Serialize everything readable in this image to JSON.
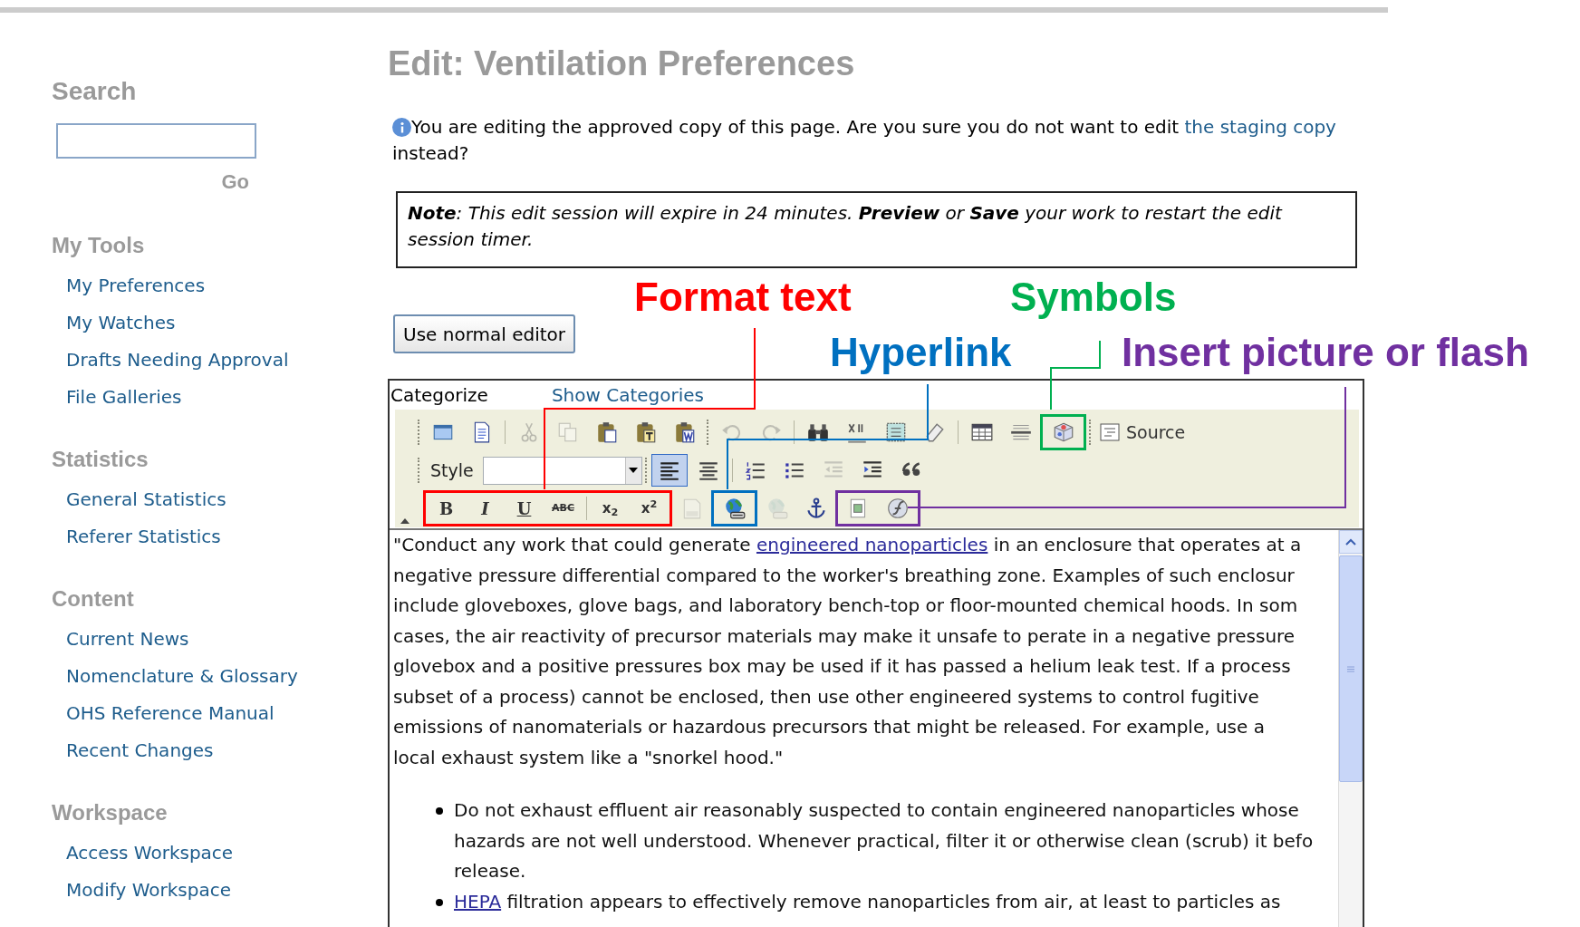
{
  "sidebar": {
    "search": {
      "heading": "Search",
      "button": "Go"
    },
    "sections": [
      {
        "heading": "My Tools",
        "items": [
          "My Preferences",
          "My Watches",
          "Drafts Needing Approval",
          "File Galleries"
        ]
      },
      {
        "heading": "Statistics",
        "items": [
          "General Statistics",
          "Referer Statistics"
        ]
      },
      {
        "heading": "Content",
        "items": [
          "Current News",
          "Nomenclature & Glossary",
          "OHS Reference Manual",
          "Recent Changes"
        ]
      },
      {
        "heading": "Workspace",
        "items": [
          "Access Workspace",
          "Modify Workspace"
        ]
      }
    ]
  },
  "page": {
    "title": "Edit: Ventilation Preferences",
    "notice": {
      "text": "You are editing the approved copy of this page. Are you sure you do not want to edit ",
      "link": "the staging copy",
      "tail": "instead?"
    },
    "note": "**Note**: This edit session will expire in 24 minutes. **Preview** or **Save** your work to restart the edit session timer.",
    "button": "Use normal editor"
  },
  "annotations": [
    {
      "text": "Format text",
      "color": "#ff0000"
    },
    {
      "text": "Symbols",
      "color": "#00b050"
    },
    {
      "text": "Hyperlink",
      "color": "#0070c0"
    },
    {
      "text": "Insert picture or flash",
      "color": "#7030a0"
    }
  ],
  "editor": {
    "categorize": "Categorize",
    "show_categories": "Show Categories",
    "toolbar": [
      [
        {
          "kind": "preview",
          "disabled": false,
          "selected": false
        },
        {
          "kind": "newpage",
          "disabled": false,
          "selected": false
        },
        {
          "kind": "divider"
        },
        {
          "kind": "cut",
          "disabled": true,
          "selected": false
        },
        {
          "kind": "copy",
          "disabled": true,
          "selected": false
        },
        {
          "kind": "paste",
          "disabled": false,
          "selected": false
        },
        {
          "kind": "pastetext",
          "disabled": false,
          "selected": false
        },
        {
          "kind": "pasteword",
          "disabled": false,
          "selected": false
        },
        {
          "kind": "grip"
        },
        {
          "kind": "undo",
          "disabled": true,
          "selected": false
        },
        {
          "kind": "redo",
          "disabled": true,
          "selected": false
        },
        {
          "kind": "divider"
        },
        {
          "kind": "find",
          "disabled": false,
          "selected": false
        },
        {
          "kind": "replace",
          "disabled": false,
          "selected": false
        },
        {
          "kind": "selectall",
          "disabled": false,
          "selected": false
        },
        {
          "kind": "removeformat",
          "disabled": false,
          "selected": false
        },
        {
          "kind": "divider"
        },
        {
          "kind": "table",
          "disabled": false,
          "selected": false
        },
        {
          "kind": "rule",
          "disabled": false,
          "selected": false
        },
        {
          "kind": "group",
          "color": "#00b050",
          "items": [
            {
              "kind": "specialchar",
              "disabled": false,
              "selected": false
            }
          ]
        },
        {
          "kind": "grip"
        },
        {
          "kind": "source",
          "label": "Source",
          "disabled": false,
          "selected": false
        }
      ],
      [
        {
          "kind": "label",
          "text": "Style"
        },
        {
          "kind": "select"
        },
        {
          "kind": "grip"
        },
        {
          "kind": "alignleft",
          "disabled": false,
          "selected": true
        },
        {
          "kind": "aligncenter",
          "disabled": false,
          "selected": false
        },
        {
          "kind": "divider"
        },
        {
          "kind": "numbered",
          "disabled": false,
          "selected": false
        },
        {
          "kind": "bulleted",
          "disabled": false,
          "selected": false
        },
        {
          "kind": "outdent",
          "disabled": true,
          "selected": false
        },
        {
          "kind": "indent",
          "disabled": false,
          "selected": false
        },
        {
          "kind": "quote",
          "disabled": false,
          "selected": false
        }
      ],
      [
        {
          "kind": "group",
          "color": "#ff0000",
          "items": [
            {
              "kind": "bold",
              "label": "B",
              "disabled": false,
              "selected": false
            },
            {
              "kind": "italic",
              "label": "I",
              "disabled": false,
              "selected": false
            },
            {
              "kind": "underline",
              "label": "U",
              "disabled": false,
              "selected": false
            },
            {
              "kind": "strike",
              "label": "ABC",
              "disabled": false,
              "selected": false
            },
            {
              "kind": "divider"
            },
            {
              "kind": "subscript",
              "label": "x$_{2}$",
              "disabled": false,
              "selected": false
            },
            {
              "kind": "superscript",
              "label": "x$^{2}$",
              "disabled": false,
              "selected": false
            }
          ]
        },
        {
          "kind": "template",
          "disabled": true,
          "selected": false
        },
        {
          "kind": "group",
          "color": "#0070c0",
          "items": [
            {
              "kind": "link",
              "disabled": false,
              "selected": false
            }
          ]
        },
        {
          "kind": "unlink",
          "disabled": true,
          "selected": false
        },
        {
          "kind": "anchor",
          "disabled": false,
          "selected": false
        },
        {
          "kind": "group",
          "color": "#7030a0",
          "items": [
            {
              "kind": "image",
              "disabled": false,
              "selected": false
            },
            {
              "kind": "flash",
              "disabled": false,
              "selected": false
            }
          ]
        }
      ]
    ],
    "paragraph": [
      [
        {
          "text": "\"Conduct any work that could generate "
        },
        {
          "link": "engineered nanoparticles"
        },
        {
          "text": " in an enclosure that operates at a"
        }
      ],
      [
        {
          "text": "negative pressure differential compared to the worker's breathing zone. Examples of such enclosur"
        }
      ],
      [
        {
          "text": "include gloveboxes, glove bags, and laboratory bench-top or floor-mounted chemical hoods. In som"
        }
      ],
      [
        {
          "text": "cases, the air reactivity of precursor materials may make it unsafe to perate in a negative pressure"
        }
      ],
      [
        {
          "text": "glovebox and a positive pressures box may be used if it has passed a helium leak test. If a process"
        }
      ],
      [
        {
          "text": "subset of a process) cannot be enclosed, then use other engineered systems to control fugitive"
        }
      ],
      [
        {
          "text": "emissions of nanomaterials or hazardous precursors that might be released. For example, use a"
        }
      ],
      [
        {
          "text": "local exhaust system like a \"snorkel hood.\""
        }
      ]
    ],
    "bullets": [
      [
        [
          {
            "text": "Do not exhaust effluent air reasonably suspected to contain engineered nanoparticles whose"
          }
        ],
        [
          {
            "text": "hazards are not well understood. Whenever practical, filter it or otherwise clean (scrub) it befo"
          }
        ],
        [
          {
            "text": "release."
          }
        ]
      ],
      [
        [
          {
            "link": "HEPA"
          },
          {
            "text": " filtration appears to effectively remove nanoparticles from air, at least to particles as"
          }
        ]
      ]
    ]
  }
}
